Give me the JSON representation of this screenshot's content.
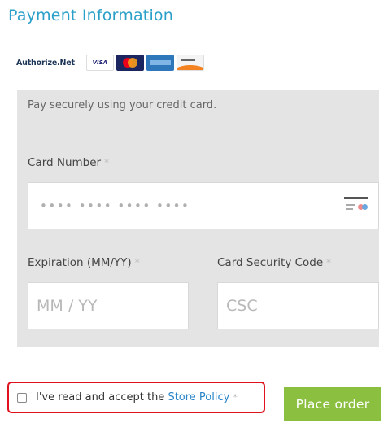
{
  "header": {
    "title": "Payment Information"
  },
  "logos": {
    "authorize_net": "Authorize.Net",
    "visa": "VISA",
    "cards": [
      "visa-logo",
      "mastercard-logo",
      "amex-logo",
      "discover-logo"
    ]
  },
  "form": {
    "intro": "Pay securely using your credit card.",
    "card_number": {
      "label": "Card Number",
      "required_mark": "*",
      "placeholder": "•••• •••• •••• ••••",
      "value": ""
    },
    "expiration": {
      "label": "Expiration (MM/YY)",
      "required_mark": "*",
      "placeholder": "MM / YY",
      "value": ""
    },
    "csc": {
      "label": "Card Security Code",
      "required_mark": "*",
      "placeholder": "CSC",
      "value": ""
    }
  },
  "policy": {
    "text": "I've read and accept the ",
    "link": "Store Policy",
    "required_mark": "*",
    "checked": false,
    "highlight_color": "#e0121e"
  },
  "actions": {
    "place_order": "Place order"
  },
  "colors": {
    "accent": "#2aa0c8",
    "button": "#8bbf3f",
    "link": "#2a85c8"
  }
}
